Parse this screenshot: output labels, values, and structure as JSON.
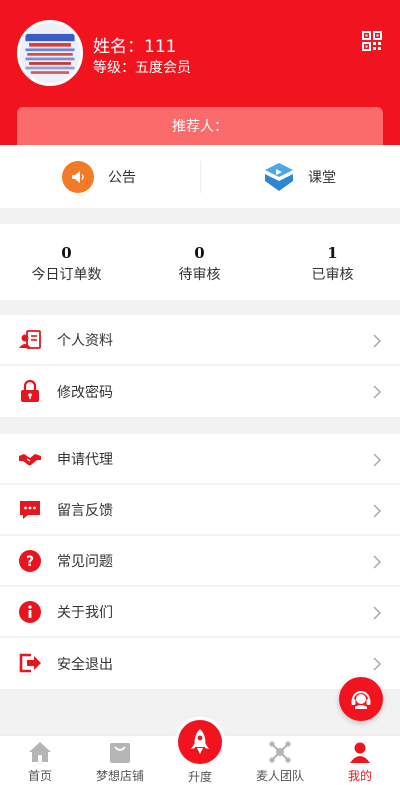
{
  "colors": {
    "brand_red": "#f1141e",
    "referrer_bg": "#fb6b6b",
    "page_bg": "#f2f2f2"
  },
  "header": {
    "name": "姓名：111",
    "level": "等级：五度会员",
    "referrer_label": "推荐人："
  },
  "quick_links": [
    {
      "label": "公告",
      "icon": "megaphone-icon"
    },
    {
      "label": "课堂",
      "icon": "classroom-icon"
    }
  ],
  "stats": [
    {
      "value": "0",
      "label": "今日订单数"
    },
    {
      "value": "0",
      "label": "待审核"
    },
    {
      "value": "1",
      "label": "已审核"
    }
  ],
  "menu_account": [
    {
      "label": "个人资料",
      "icon": "profile-card-icon"
    },
    {
      "label": "修改密码",
      "icon": "lock-icon"
    }
  ],
  "menu_more": [
    {
      "label": "申请代理",
      "icon": "handshake-icon"
    },
    {
      "label": "留言反馈",
      "icon": "chat-bubble-icon"
    },
    {
      "label": "常见问题",
      "icon": "question-icon"
    },
    {
      "label": "关于我们",
      "icon": "info-icon"
    },
    {
      "label": "安全退出",
      "icon": "logout-icon"
    }
  ],
  "tabbar": [
    {
      "label": "首页",
      "icon": "home-icon"
    },
    {
      "label": "梦想店铺",
      "icon": "shop-bag-icon"
    },
    {
      "label": "升度",
      "icon": "rocket-icon"
    },
    {
      "label": "麦人团队",
      "icon": "network-icon"
    },
    {
      "label": "我的",
      "icon": "user-icon",
      "active": true
    }
  ]
}
